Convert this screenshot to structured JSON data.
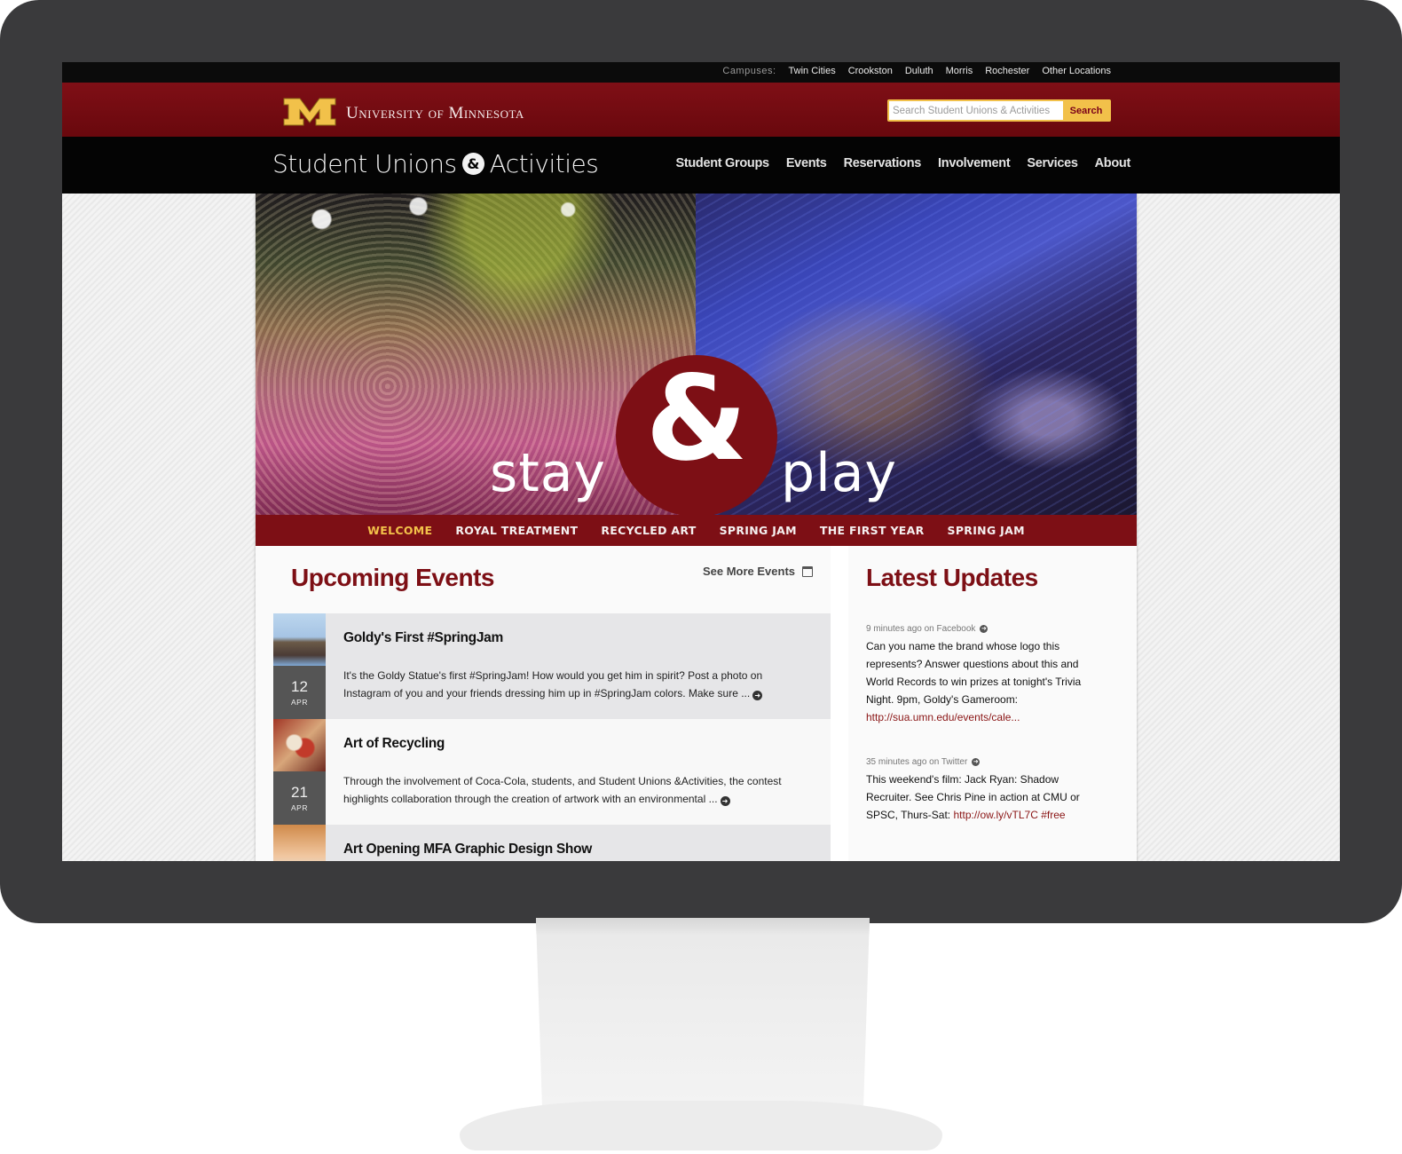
{
  "campus_bar": {
    "label": "Campuses:",
    "links": [
      "Twin Cities",
      "Crookston",
      "Duluth",
      "Morris",
      "Rochester",
      "Other Locations"
    ]
  },
  "umn_header": {
    "wordmark": "University of Minnesota",
    "search_placeholder": "Search Student Unions & Activities",
    "search_button": "Search"
  },
  "site_nav": {
    "site_name_left": "Student Unions",
    "site_name_amp": "&",
    "site_name_right": "Activities",
    "menu": [
      "Student Groups",
      "Events",
      "Reservations",
      "Involvement",
      "Services",
      "About"
    ]
  },
  "hero": {
    "word_left": "stay",
    "ampersand": "&",
    "word_right": "play"
  },
  "slider_tabs": [
    {
      "label": "WELCOME",
      "active": true
    },
    {
      "label": "ROYAL TREATMENT",
      "active": false
    },
    {
      "label": "RECYCLED ART",
      "active": false
    },
    {
      "label": "SPRING JAM",
      "active": false
    },
    {
      "label": "THE FIRST YEAR",
      "active": false
    },
    {
      "label": "SPRING JAM",
      "active": false
    }
  ],
  "events": {
    "title": "Upcoming Events",
    "see_more": "See More Events",
    "items": [
      {
        "title": "Goldy's First #SpringJam",
        "day": "12",
        "month": "APR",
        "description": "It's the Goldy Statue's first #SpringJam! How would you get him in spirit? Post a photo on Instagram of you and your friends dressing him up in #SpringJam colors. Make sure ..."
      },
      {
        "title": "Art of Recycling",
        "day": "21",
        "month": "APR",
        "description": "Through the involvement of Coca-Cola, students, and Student Unions &Activities, the contest highlights collaboration through the creation of artwork with an environmental ..."
      },
      {
        "title": "Art Opening MFA Graphic Design Show"
      }
    ]
  },
  "updates": {
    "title": "Latest Updates",
    "items": [
      {
        "meta": "9 minutes ago on Facebook",
        "text": "Can you name the brand whose logo this represents? Answer questions about this and World Records to win prizes at tonight's Trivia Night. 9pm, Goldy's Gameroom: ",
        "link": "http://sua.umn.edu/events/cale..."
      },
      {
        "meta": "35 minutes ago on Twitter",
        "text": "This weekend's film: Jack Ryan: Shadow Recruiter. See Chris Pine in action at CMU or SPSC, Thurs-Sat: ",
        "link": "http://ow.ly/vTL7C #free"
      }
    ]
  },
  "colors": {
    "maroon": "#7d0f15",
    "gold": "#f2c14a",
    "monitor_bezel": "#3a3a3c"
  }
}
